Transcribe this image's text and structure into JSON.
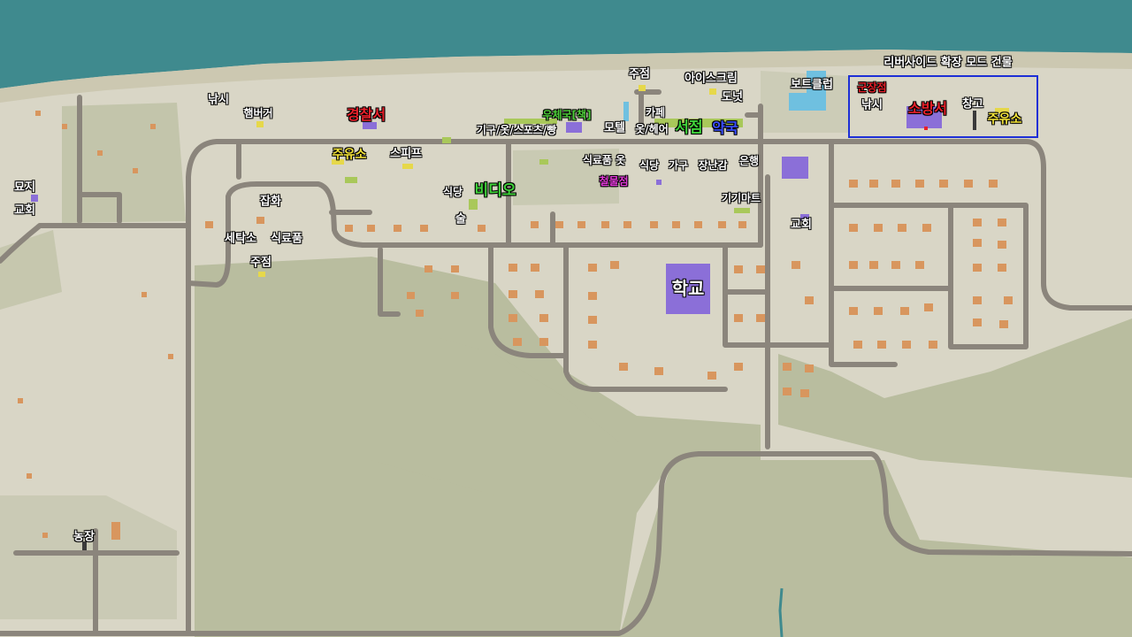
{
  "colors": {
    "water": "#3f8a8e",
    "shore": "#d2ceb8",
    "land": "#d9d6c6",
    "forest": "#b9bd9f",
    "road": "#8b857c",
    "house": "#d8965e",
    "building": "#8b6fd8",
    "highlight_border": "#1d2fd6"
  },
  "labels": {
    "fishing_west": "낚시",
    "hamburger": "햄버거",
    "police": "경찰서",
    "gas_station_1": "주유소",
    "sports": "스피프",
    "cemetery": "묘지",
    "church_west": "교회",
    "general_store": "잡화",
    "laundry": "세탁소",
    "grocery_1": "식료품",
    "liquor_1": "주점",
    "restaurant_1": "식당",
    "video": "비디오",
    "bar": "술",
    "furniture_misc": "기구/옷/스포츠/빵",
    "post_office": "우체국[책]",
    "liquor_2": "주점",
    "ice_cream": "아이스크림",
    "donut": "도넛",
    "cafe": "카페",
    "motel": "모텔",
    "clothes_hair": "옷/헤어",
    "bookstore": "서점",
    "pharmacy": "약국",
    "grocery_clothes": "식료품 옷",
    "hardware": "철물점",
    "restaurant_2": "식당",
    "furniture": "가구",
    "toys": "장난감",
    "bank": "은행",
    "electronics": "기기마트",
    "church_center": "교회",
    "school": "학교",
    "boat_club": "보트클럽",
    "riverside_mod": "리버사이드 확장 모드 건물",
    "military_surplus": "군장점",
    "fishing_east": "낚시",
    "fire_station": "소방서",
    "warehouse": "창고",
    "gas_station_2": "주유소",
    "farm": "농장"
  }
}
